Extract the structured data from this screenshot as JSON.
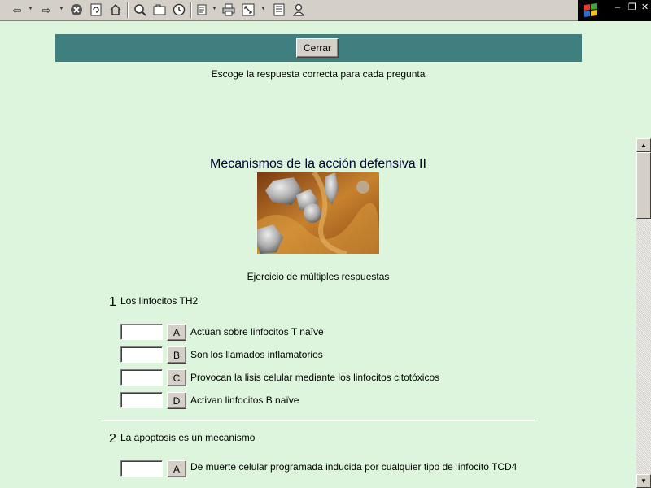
{
  "toolbar": {
    "icons": [
      "back-icon",
      "forward-icon",
      "stop-icon",
      "refresh-icon",
      "home-icon",
      "search-icon",
      "favorites-icon",
      "history-icon",
      "edit-icon",
      "print-icon",
      "fullscreen-icon",
      "page-icon",
      "user-icon"
    ]
  },
  "header": {
    "close_label": "Cerrar",
    "instructions": "Escoge la respuesta correcta para cada pregunta"
  },
  "main": {
    "title": "Mecanismos de la acción defensiva II",
    "subtitle": "Ejercicio de múltiples respuestas"
  },
  "questions": [
    {
      "number": "1",
      "text": "Los linfocitos TH2",
      "answers": [
        {
          "letter": "A",
          "text": "Actúan sobre linfocitos T naïve",
          "value": ""
        },
        {
          "letter": "B",
          "text": "Son los llamados inflamatorios",
          "value": ""
        },
        {
          "letter": "C",
          "text": "Provocan la lisis celular mediante los linfocitos citotóxicos",
          "value": ""
        },
        {
          "letter": "D",
          "text": "Activan linfocitos B naïve",
          "value": ""
        }
      ]
    },
    {
      "number": "2",
      "text": "La apoptosis es un mecanismo",
      "answers": [
        {
          "letter": "A",
          "text": "De muerte celular programada inducida por cualquier tipo de linfocito TCD4",
          "value": ""
        }
      ]
    }
  ],
  "colors": {
    "page_bg": "#dcf5dc",
    "header_bar": "#3f7f7f",
    "title_color": "#000033"
  }
}
